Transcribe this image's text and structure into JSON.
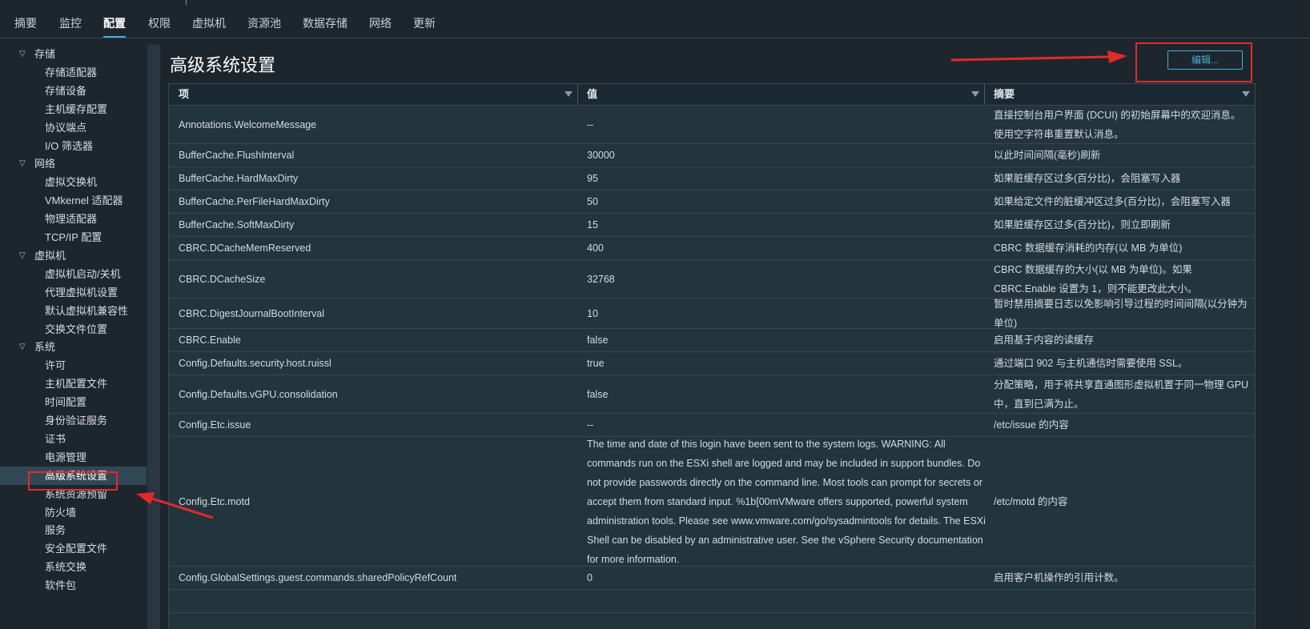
{
  "tabs": [
    "摘要",
    "监控",
    "配置",
    "权限",
    "虚拟机",
    "资源池",
    "数据存储",
    "网络",
    "更新"
  ],
  "active_tab": "配置",
  "sidebar": {
    "groups": [
      {
        "label": "存储",
        "items": [
          "存储适配器",
          "存储设备",
          "主机缓存配置",
          "协议端点",
          "I/O 筛选器"
        ]
      },
      {
        "label": "网络",
        "items": [
          "虚拟交换机",
          "VMkernel 适配器",
          "物理适配器",
          "TCP/IP 配置"
        ]
      },
      {
        "label": "虚拟机",
        "items": [
          "虚拟机启动/关机",
          "代理虚拟机设置",
          "默认虚拟机兼容性",
          "交换文件位置"
        ]
      },
      {
        "label": "系统",
        "items": [
          "许可",
          "主机配置文件",
          "时间配置",
          "身份验证服务",
          "证书",
          "电源管理",
          "高级系统设置",
          "系统资源预留",
          "防火墙",
          "服务",
          "安全配置文件",
          "系统交换",
          "软件包"
        ]
      }
    ],
    "selected": "高级系统设置"
  },
  "main": {
    "title": "高级系统设置",
    "edit_label": "编辑..."
  },
  "table": {
    "headers": [
      "项",
      "值",
      "摘要"
    ],
    "rows": [
      {
        "key": "Annotations.WelcomeMessage",
        "value": "--",
        "summary": "直接控制台用户界面 (DCUI) 的初始屏幕中的欢迎消息。使用空字符串重置默认消息。"
      },
      {
        "key": "BufferCache.FlushInterval",
        "value": "30000",
        "summary": "以此时间间隔(毫秒)刷新"
      },
      {
        "key": "BufferCache.HardMaxDirty",
        "value": "95",
        "summary": "如果脏缓存区过多(百分比)，会阻塞写入器"
      },
      {
        "key": "BufferCache.PerFileHardMaxDirty",
        "value": "50",
        "summary": "如果给定文件的脏缓冲区过多(百分比)，会阻塞写入器"
      },
      {
        "key": "BufferCache.SoftMaxDirty",
        "value": "15",
        "summary": "如果脏缓存区过多(百分比)，则立即刷新"
      },
      {
        "key": "CBRC.DCacheMemReserved",
        "value": "400",
        "summary": "CBRC 数据缓存消耗的内存(以 MB 为单位)"
      },
      {
        "key": "CBRC.DCacheSize",
        "value": "32768",
        "summary": "CBRC 数据缓存的大小(以 MB 为单位)。如果 CBRC.Enable 设置为 1，则不能更改此大小。"
      },
      {
        "key": "CBRC.DigestJournalBootInterval",
        "value": "10",
        "summary": "暂时禁用摘要日志以免影响引导过程的时间间隔(以分钟为单位)"
      },
      {
        "key": "CBRC.Enable",
        "value": "false",
        "summary": "启用基于内容的读缓存"
      },
      {
        "key": "Config.Defaults.security.host.ruissl",
        "value": "true",
        "summary": "通过端口 902 与主机通信时需要使用 SSL。"
      },
      {
        "key": "Config.Defaults.vGPU.consolidation",
        "value": "false",
        "summary": "分配策略，用于将共享直通图形虚拟机置于同一物理 GPU 中，直到已满为止。"
      },
      {
        "key": "Config.Etc.issue",
        "value": "--",
        "summary": "/etc/issue 的内容"
      },
      {
        "key": "Config.Etc.motd",
        "value": "The time and date of this login have been sent to the system logs. WARNING: All commands run on the ESXi shell are logged and may be included in support bundles. Do not provide passwords directly on the command line. Most tools can prompt for secrets or accept them from standard input. %1b[00mVMware offers supported, powerful system administration tools. Please see www.vmware.com/go/sysadmintools for details. The ESXi Shell can be disabled by an administrative user. See the vSphere Security documentation for more information.",
        "summary": "/etc/motd 的内容"
      },
      {
        "key": "Config.GlobalSettings.guest.commands.sharedPolicyRefCount",
        "value": "0",
        "summary": "启用客户机操作的引用计数。"
      }
    ]
  },
  "colors": {
    "accent": "#49afd9",
    "highlight": "#e02b2b",
    "background": "#1d262d",
    "grid": "#22343c"
  }
}
